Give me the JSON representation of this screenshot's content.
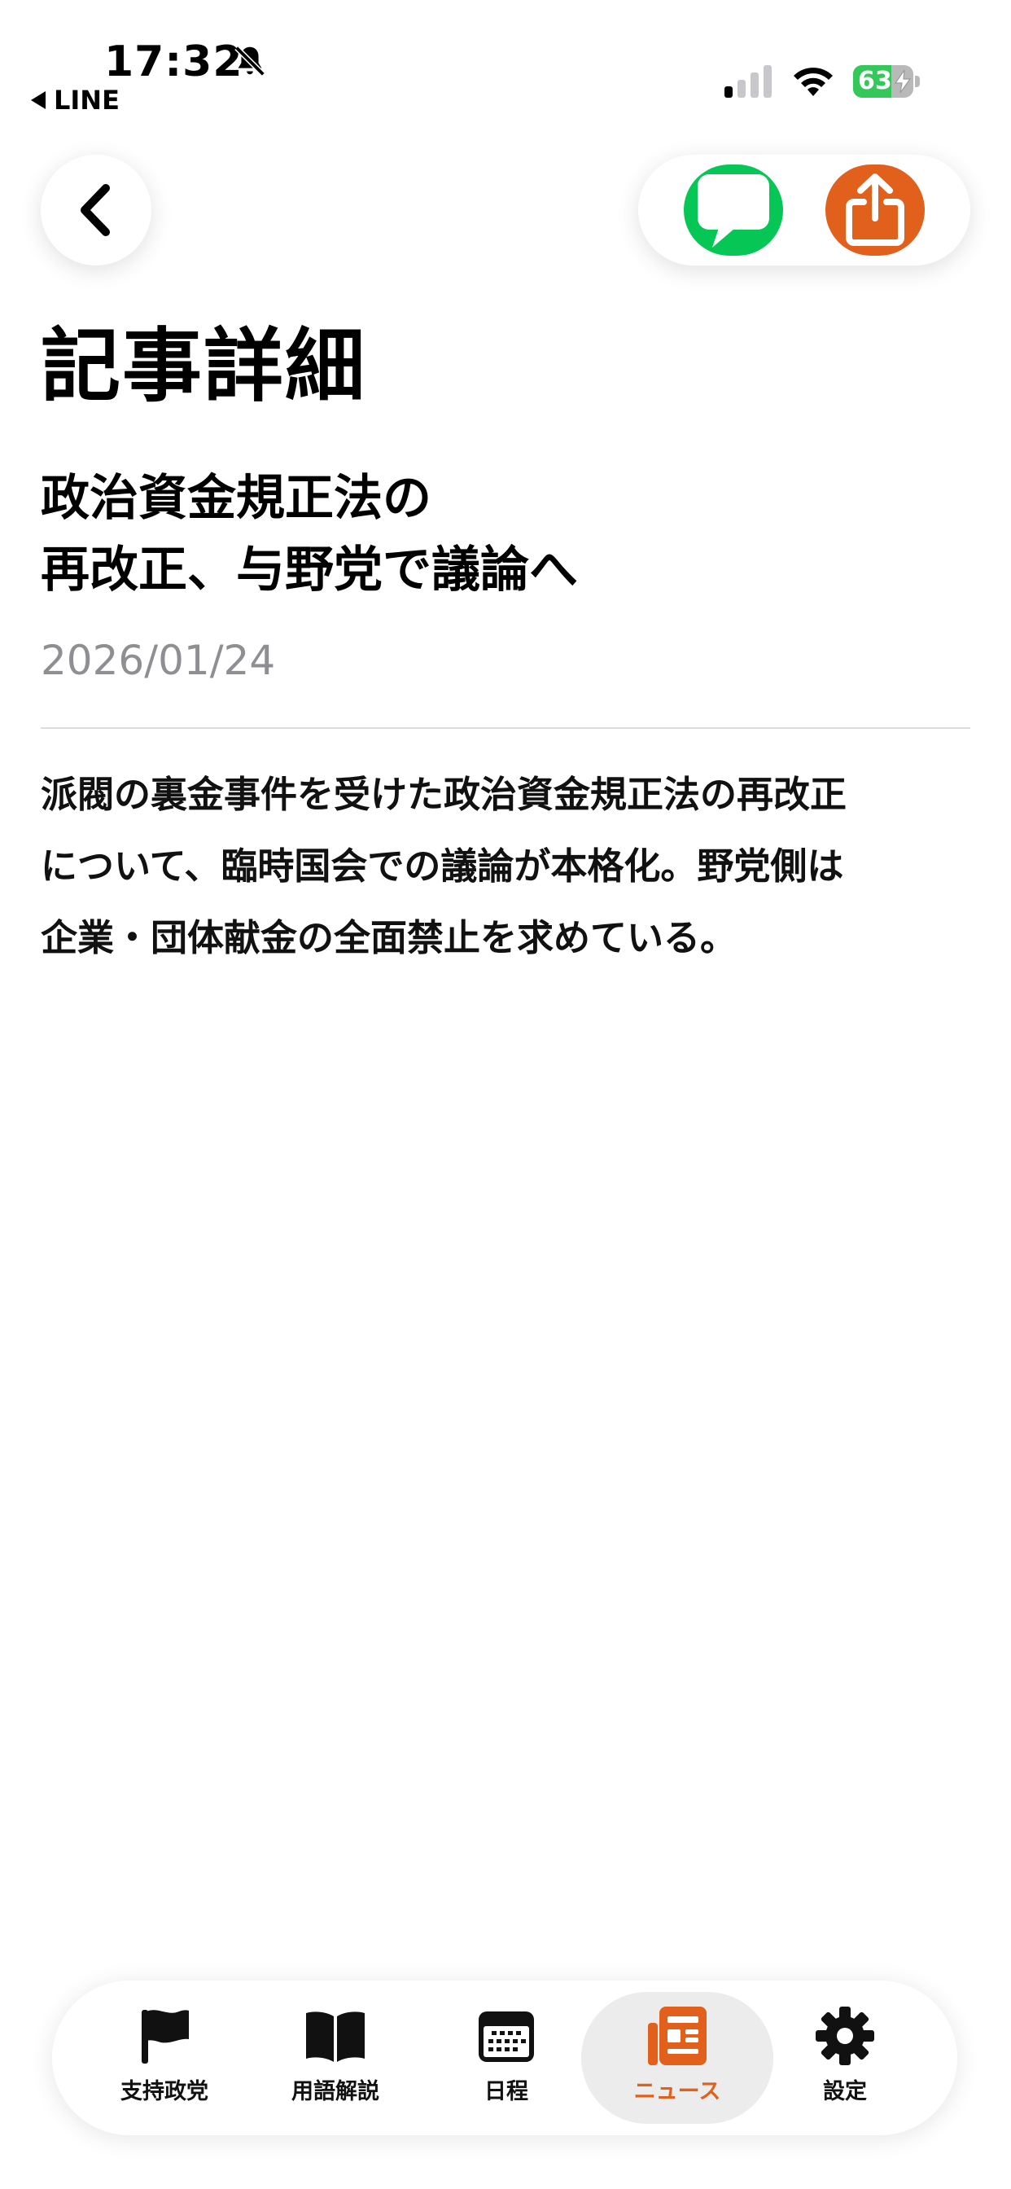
{
  "status_bar": {
    "time": "17:32",
    "back_app": "LINE",
    "battery_percent": "63",
    "battery_level": 0.63
  },
  "page": {
    "title": "記事詳細"
  },
  "article": {
    "title_line1": "政治資金規正法の",
    "title_line2": "再改正、与野党で議論へ",
    "date": "2026/01/24",
    "body_line1": "派閥の裏金事件を受けた政治資金規正法の再改正",
    "body_line2": "について、臨時国会での議論が本格化。野党側は",
    "body_line3": "企業・団体献金の全面禁止を求めている。"
  },
  "tab_bar": {
    "tabs": [
      {
        "label": "支持政党",
        "icon": "flag-icon"
      },
      {
        "label": "用語解説",
        "icon": "book-icon"
      },
      {
        "label": "日程",
        "icon": "calendar-icon"
      },
      {
        "label": "ニュース",
        "icon": "newspaper-icon",
        "active": true
      },
      {
        "label": "設定",
        "icon": "gear-icon"
      }
    ]
  },
  "colors": {
    "accent": "#e0601c",
    "line_green": "#06c755",
    "battery_green": "#34c759",
    "muted_text": "#8e8e93"
  }
}
